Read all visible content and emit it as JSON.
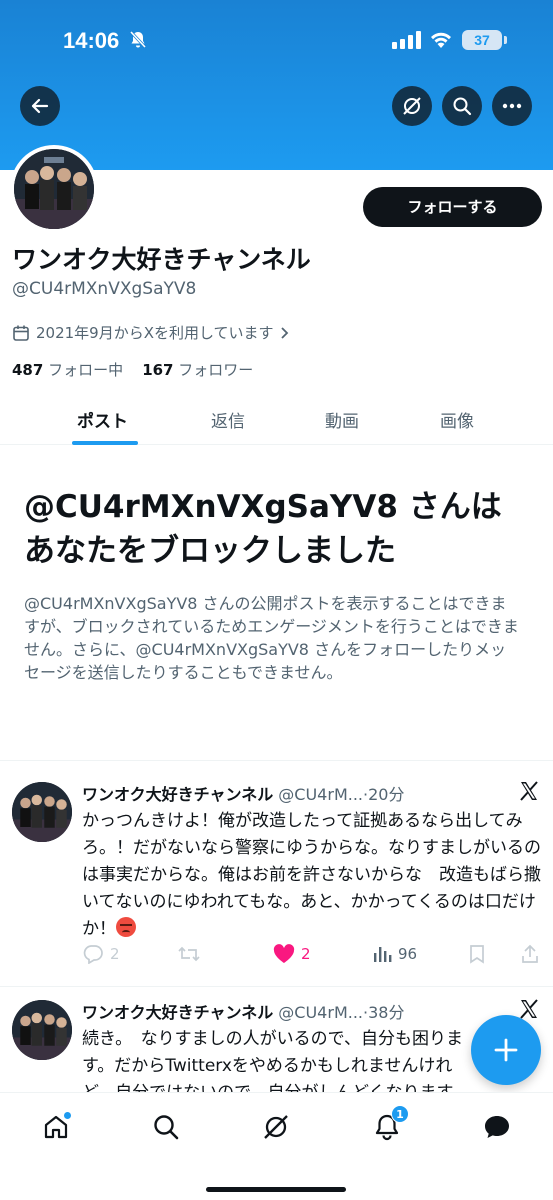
{
  "status_bar": {
    "time": "14:06",
    "battery": "37"
  },
  "profile": {
    "display_name": "ワンオク大好きチャンネル",
    "handle": "@CU4rMXnVXgSaYV8",
    "joined": "2021年9月からXを利用しています",
    "following_count": "487",
    "following_label": "フォロー中",
    "followers_count": "167",
    "followers_label": "フォロワー",
    "follow_button": "フォローする"
  },
  "tabs": [
    "ポスト",
    "返信",
    "動画",
    "画像"
  ],
  "blocked": {
    "title": "@CU4rMXnVXgSaYV8 さんはあなたをブロックしました",
    "description": "@CU4rMXnVXgSaYV8 さんの公開ポストを表示することはできますが、ブロックされているためエンゲージメントを行うことはできません。さらに、@CU4rMXnVXgSaYV8 さんをフォローしたりメッセージを送信したりすることもできません。"
  },
  "tweets": [
    {
      "name": "ワンオク大好きチャンネル",
      "meta": "@CU4rM...·20分",
      "text": "かっつんきけよ！俺が改造したって証拠あるなら出してみろ。！だがないなら警察にゆうからな。なりすましがいるのは事実だからな。俺はお前を許さないからな　改造もばら撒いてないのにゆわれてもな。あと、かかってくるのは口だけか！",
      "replies": "2",
      "likes": "2",
      "views": "96"
    },
    {
      "name": "ワンオク大好きチャンネル",
      "meta": "@CU4rM...·38分",
      "text": "続き。　なりすましの人がいるので、自分も困ります。だからTwitterxをやめるかもしれませんけれど、自分ではないので。自分がしんどくなります"
    }
  ],
  "colors": {
    "accent": "#1d9bf0",
    "like": "#f91880",
    "text": "#0f1419",
    "muted": "#536471"
  },
  "notifications_badge": "1"
}
